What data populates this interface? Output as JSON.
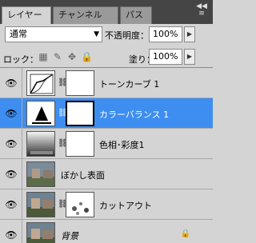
{
  "tabs": [
    {
      "label": "レイヤー",
      "close": "×"
    },
    {
      "label": "チャンネル"
    },
    {
      "label": "パス"
    }
  ],
  "panel_menu_icon": "panel-menu-icon",
  "blend": {
    "mode": "通常",
    "opacity_label": "不透明度：",
    "opacity_value": "100%"
  },
  "lock": {
    "label": "ロック：",
    "fill_label": "塗り：",
    "fill_value": "100%"
  },
  "layers": [
    {
      "name": "トーンカーブ 1"
    },
    {
      "name": "カラーバランス 1"
    },
    {
      "name": "色相･彩度1"
    },
    {
      "name": "ぼかし表面"
    },
    {
      "name": "カットアウト"
    },
    {
      "name": "背景"
    }
  ],
  "colors": {
    "selected": "#3d8ef0",
    "panel": "#d4d4d4",
    "tabbar": "#454545"
  }
}
